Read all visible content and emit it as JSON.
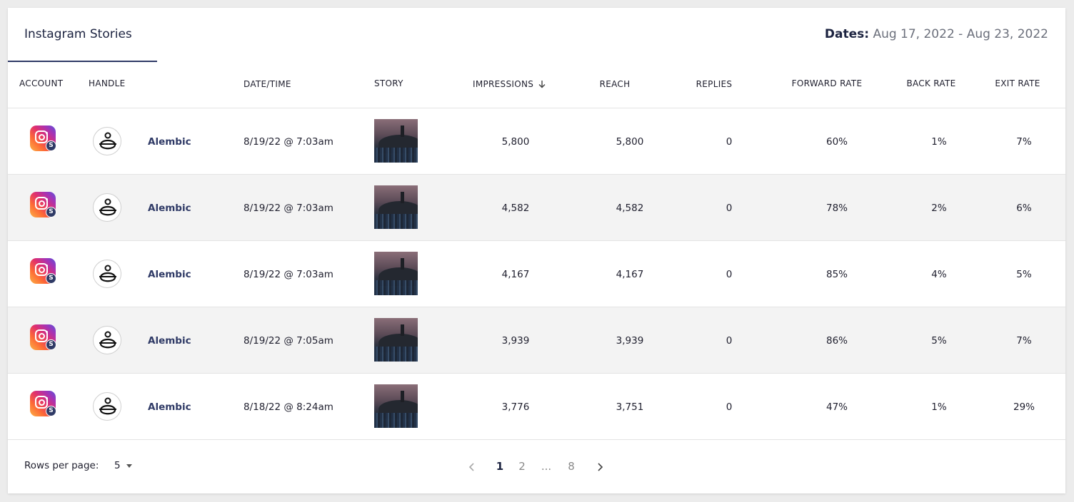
{
  "header": {
    "tab_label": "Instagram Stories",
    "dates_label": "Dates:",
    "dates_value": "Aug 17, 2022 - Aug 23, 2022"
  },
  "columns": {
    "account": "ACCOUNT",
    "handle": "HANDLE",
    "datetime": "DATE/TIME",
    "story": "STORY",
    "impressions": "IMPRESSIONS",
    "reach": "REACH",
    "replies": "REPLIES",
    "forward_rate": "FORWARD RATE",
    "back_rate": "BACK RATE",
    "exit_rate": "EXIT RATE"
  },
  "rows": [
    {
      "handle": "Alembic",
      "datetime": "8/19/22 @ 7:03am",
      "impressions": "5,800",
      "reach": "5,800",
      "replies": "0",
      "forward_rate": "60%",
      "back_rate": "1%",
      "exit_rate": "7%"
    },
    {
      "handle": "Alembic",
      "datetime": "8/19/22 @ 7:03am",
      "impressions": "4,582",
      "reach": "4,582",
      "replies": "0",
      "forward_rate": "78%",
      "back_rate": "2%",
      "exit_rate": "6%"
    },
    {
      "handle": "Alembic",
      "datetime": "8/19/22 @ 7:03am",
      "impressions": "4,167",
      "reach": "4,167",
      "replies": "0",
      "forward_rate": "85%",
      "back_rate": "4%",
      "exit_rate": "5%"
    },
    {
      "handle": "Alembic",
      "datetime": "8/19/22 @ 7:05am",
      "impressions": "3,939",
      "reach": "3,939",
      "replies": "0",
      "forward_rate": "86%",
      "back_rate": "5%",
      "exit_rate": "7%"
    },
    {
      "handle": "Alembic",
      "datetime": "8/18/22 @ 8:24am",
      "impressions": "3,776",
      "reach": "3,751",
      "replies": "0",
      "forward_rate": "47%",
      "back_rate": "1%",
      "exit_rate": "29%"
    }
  ],
  "badge_letter": "S",
  "icons": {
    "account": "instagram-icon",
    "handle": "alembic-logo-icon",
    "sort": "arrow-down-icon",
    "prev": "chevron-left-icon",
    "next": "chevron-right-icon",
    "dropdown": "caret-down-icon"
  },
  "footer": {
    "rows_per_page_label": "Rows per page:",
    "rows_per_page_value": "5",
    "pages": [
      "1",
      "2",
      "...",
      "8"
    ],
    "current_page": "1"
  },
  "colors": {
    "accent": "#2f3a66",
    "row_alt": "#f3f3f3"
  }
}
